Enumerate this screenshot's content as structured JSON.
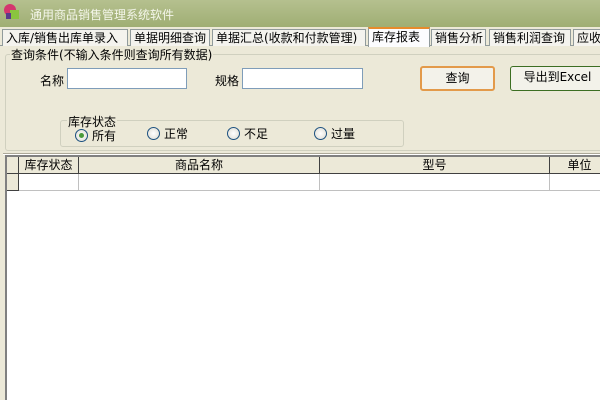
{
  "window": {
    "title": "通用商品销售管理系统软件"
  },
  "tabs": [
    "入库/销售出库单录入",
    "单据明细查询",
    "单据汇总(收款和付款管理)",
    "库存报表",
    "销售分析",
    "销售利润查询",
    "应收"
  ],
  "active_tab": "库存报表",
  "query": {
    "group_label": "查询条件(不输入条件则查询所有数据)",
    "name_label": "名称",
    "name_value": "",
    "spec_label": "规格",
    "spec_value": "",
    "query_button": "查询",
    "export_button": "导出到Excel"
  },
  "stock_status": {
    "label": "库存状态",
    "options": [
      "所有",
      "正常",
      "不足",
      "过量"
    ],
    "selected": "所有"
  },
  "grid": {
    "columns": [
      "库存状态",
      "商品名称",
      "型号",
      "单位"
    ],
    "rows": []
  }
}
